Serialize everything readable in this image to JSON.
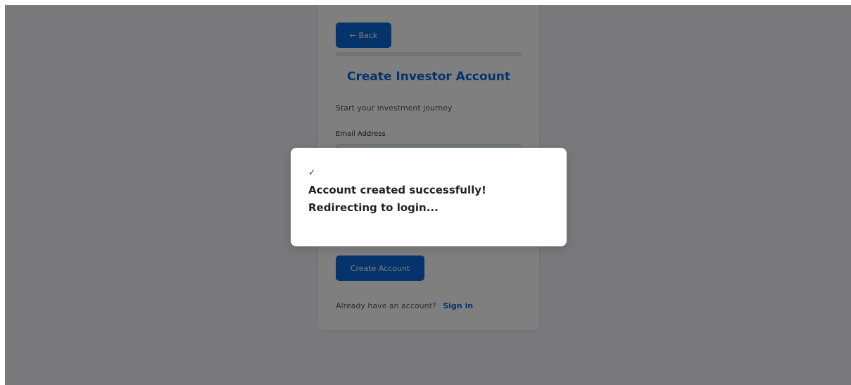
{
  "card": {
    "back_label": "← Back",
    "title": "Create Investor Account",
    "subtitle": "Start your investment journey",
    "email_label": "Email Address",
    "email_value": "",
    "create_label": "Create Account",
    "signin_prompt": "Already have an account?",
    "signin_link": "Sign in"
  },
  "modal": {
    "icon": "check-icon",
    "icon_glyph": "✓",
    "message": "Account created successfully! Redirecting to login..."
  },
  "colors": {
    "accent": "#0a66d6",
    "overlay": "rgba(0,0,0,0.5)"
  }
}
